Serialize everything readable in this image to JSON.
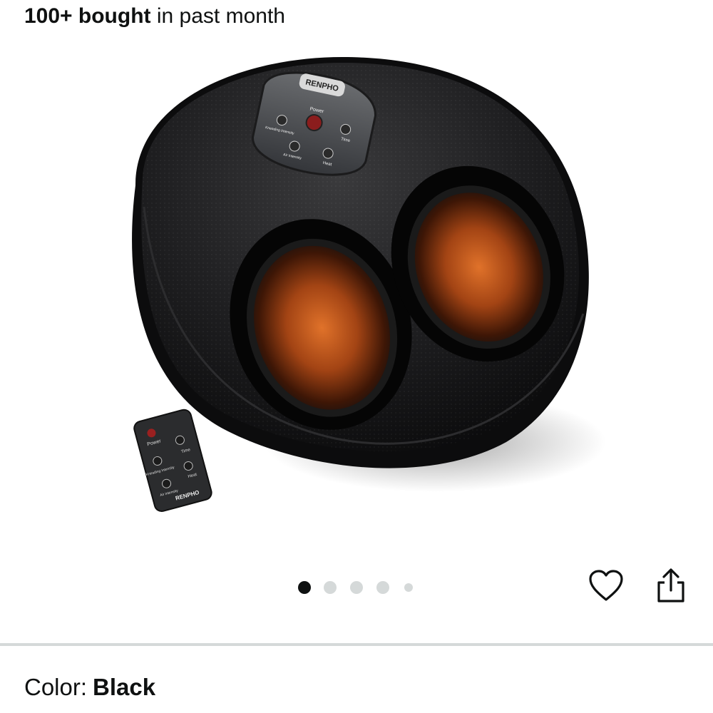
{
  "social_proof": {
    "count_text": "100+ bought",
    "suffix_text": "in past month"
  },
  "product_image": {
    "brand_name": "RENPHO",
    "panel_labels": {
      "power": "Power",
      "time": "Time",
      "kneading": "Kneading Intensity",
      "air": "Air Intensity",
      "heat": "Heat"
    },
    "remote_labels": {
      "power": "Power",
      "time": "Time",
      "kneading": "Kneading Intensity",
      "heat": "Heat",
      "air": "Air Intensity",
      "brand": "RENPHO"
    }
  },
  "carousel": {
    "total_dots": 5,
    "active_index": 0
  },
  "actions": {
    "wishlist_icon": "heart-icon",
    "share_icon": "share-icon"
  },
  "variant": {
    "label": "Color:",
    "value": "Black"
  }
}
